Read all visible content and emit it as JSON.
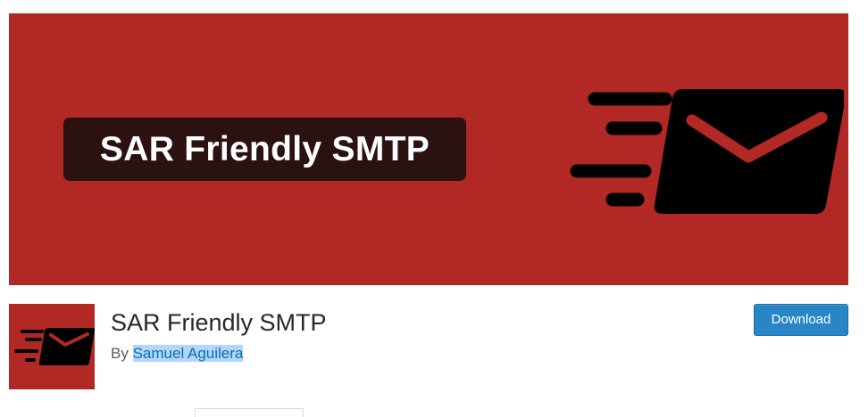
{
  "banner": {
    "title": "SAR Friendly SMTP",
    "background_color": "#b22825",
    "title_box_color": "#2b1211",
    "icon": "envelope-speed-icon"
  },
  "plugin": {
    "name": "SAR Friendly SMTP",
    "by_label": "By",
    "author": "Samuel Aguilera",
    "icon": "envelope-speed-icon"
  },
  "actions": {
    "download_label": "Download",
    "download_color": "#2986c6"
  },
  "colors": {
    "title_text": "#23282d",
    "meta_text": "#555d66",
    "link": "#0073aa",
    "selection": "#b4d5fe"
  }
}
